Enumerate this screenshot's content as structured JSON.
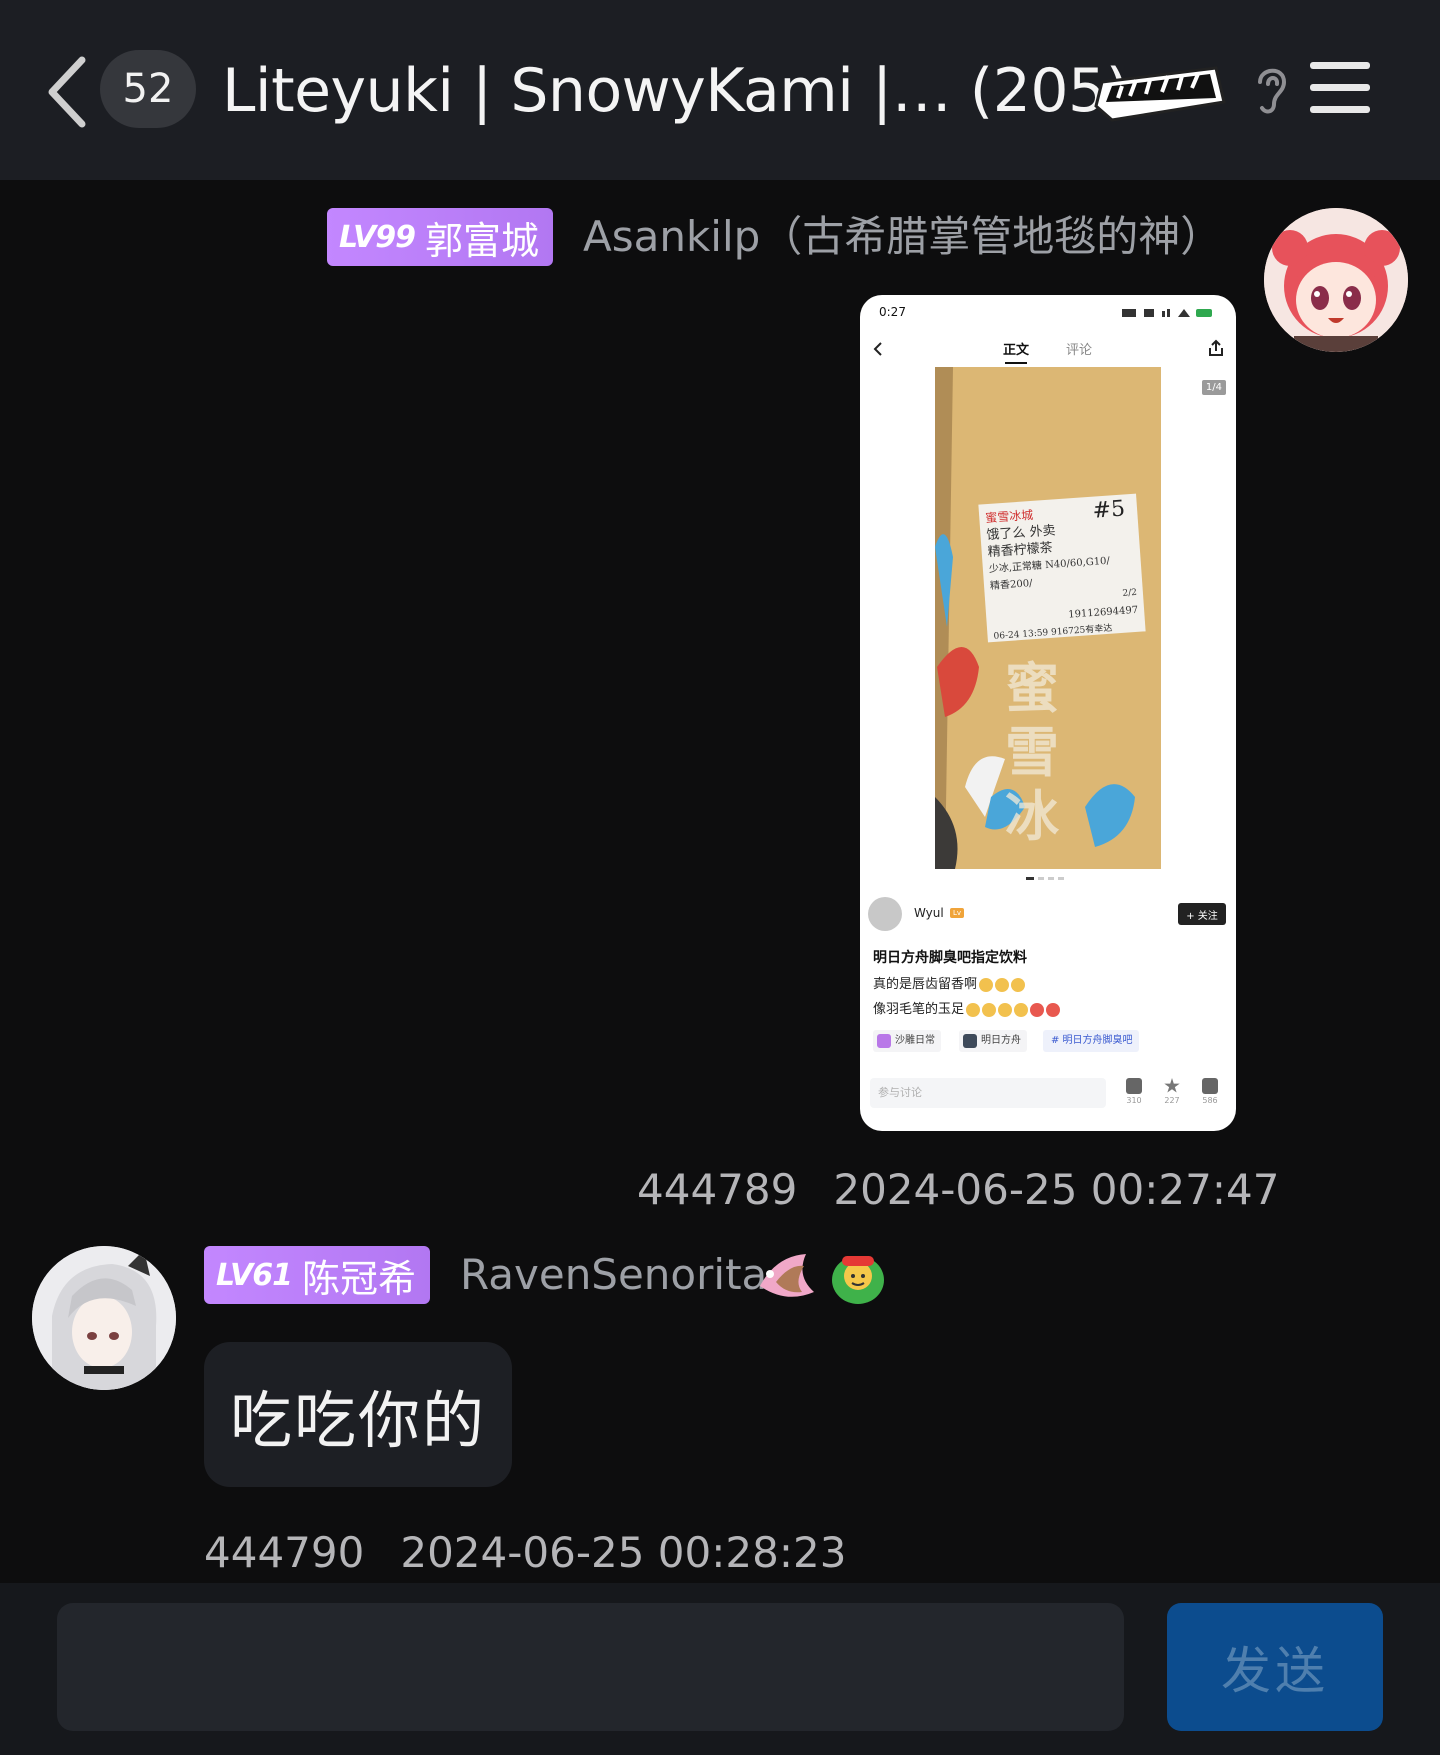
{
  "header": {
    "back_icon": "chevron-left-icon",
    "unread_count": "52",
    "title": "Liteyuki | SnowyKami |…  (205)",
    "sticker": "hooray-sticker",
    "ear_icon": "ear-icon",
    "menu_icon": "menu-icon"
  },
  "messages": [
    {
      "level": "LV99",
      "title": "郭富城",
      "nickname": "Asankilp（古希腊掌管地毯的神）",
      "id": "444789",
      "time": "2024-06-25 00:27:47",
      "shared_image": {
        "status_time": "0:27",
        "tab_main": "正文",
        "tab_comment": "评论",
        "pager": "1/4",
        "label_brand": "蜜雪冰城",
        "label_num": "#5",
        "label_line1": "饿了么 外卖",
        "label_line2": "精香柠檬茶",
        "label_line3": "少冰,正常糖 N40/60,G10/",
        "label_line4": "精香200/",
        "label_line5": "06-24 13:59 916725有幸达",
        "label_fraction": "2/2",
        "label_phone": "19112694497",
        "cup_text": "蜜雪冰",
        "author": "Wyul",
        "follow": "+ 关注",
        "post_title": "明日方舟脚臭吧指定饮料",
        "post_line1": "真的是唇齿留香啊",
        "post_line2": "像羽毛笔的玉足",
        "tags": [
          "沙雕日常",
          "明日方舟",
          "# 明日方舟脚臭吧"
        ],
        "comment_placeholder": "参与讨论",
        "likes": "310",
        "stars": "227",
        "comments": "586"
      }
    },
    {
      "level": "LV61",
      "title": "陈冠希",
      "nickname": "RavenSenorita",
      "text": "吃吃你的",
      "id": "444790",
      "time": "2024-06-25 00:28:23"
    }
  ],
  "input": {
    "value": "",
    "send_label": "发送"
  }
}
